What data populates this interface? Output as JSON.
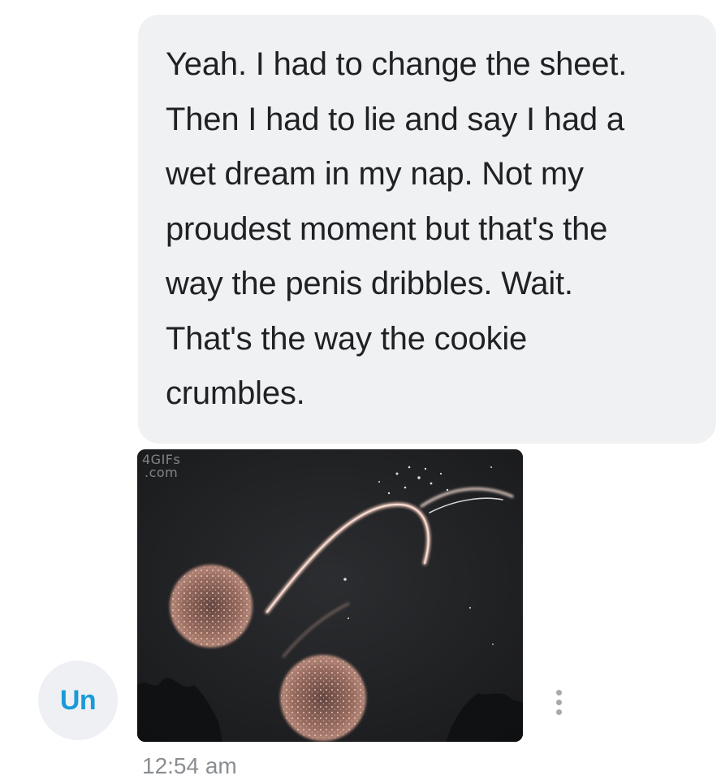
{
  "message": {
    "lines": [
      "Yeah. I had to change the sheet.",
      "Then I had to lie and say I had a",
      "wet dream in my nap. Not my",
      "proudest moment but that's the",
      "way the penis dribbles. Wait.",
      "That's the way the cookie",
      "crumbles."
    ],
    "bubble_color": "#f0f1f3",
    "text_color": "#202124"
  },
  "attachment": {
    "type": "gif",
    "watermark": {
      "line1": "4GIFs",
      "line2": ".com"
    },
    "sky_color": "#232426",
    "firework_color": "#e8b9a8"
  },
  "sender": {
    "initials": "Un",
    "initials_color": "#1a9bd7",
    "avatar_bg": "#eef0f3"
  },
  "actions": {
    "more_icon": "vertical-ellipsis-icon"
  },
  "timestamp": "12:54 am"
}
